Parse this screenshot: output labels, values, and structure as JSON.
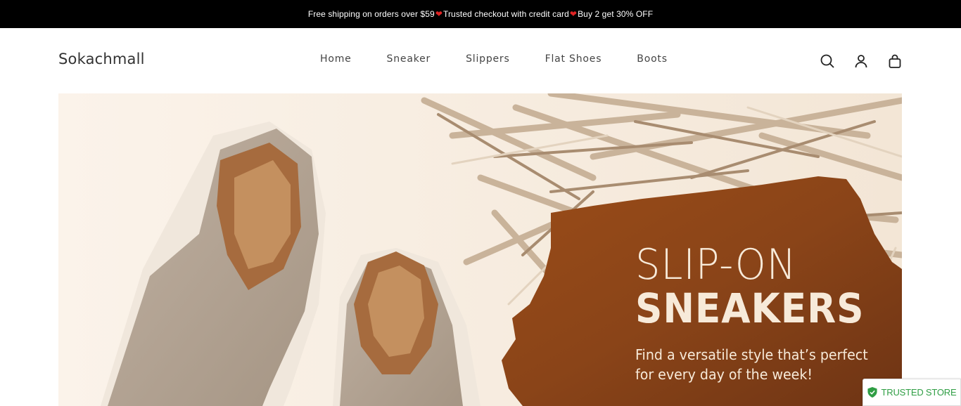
{
  "announcement": {
    "part1": "Free shipping on orders over $59",
    "part2": " Trusted checkout with credit card ",
    "part3": "Buy 2 get 30% OFF",
    "heart_color": "#e02424"
  },
  "header": {
    "logo": "Sokachmall",
    "nav": [
      "Home",
      "Sneaker",
      "Slippers",
      "Flat Shoes",
      "Boots"
    ],
    "icons": [
      "search-icon",
      "account-icon",
      "cart-icon"
    ]
  },
  "hero": {
    "title_line1": "SLIP-ON",
    "title_line2": "SNEAKERS",
    "subtitle_line1": "Find a versatile style that’s perfect",
    "subtitle_line2": "for every day of the week!",
    "accent_color": "#8a4418"
  },
  "badge": {
    "label": "TRUSTED STORE",
    "color": "#2f9e44"
  }
}
